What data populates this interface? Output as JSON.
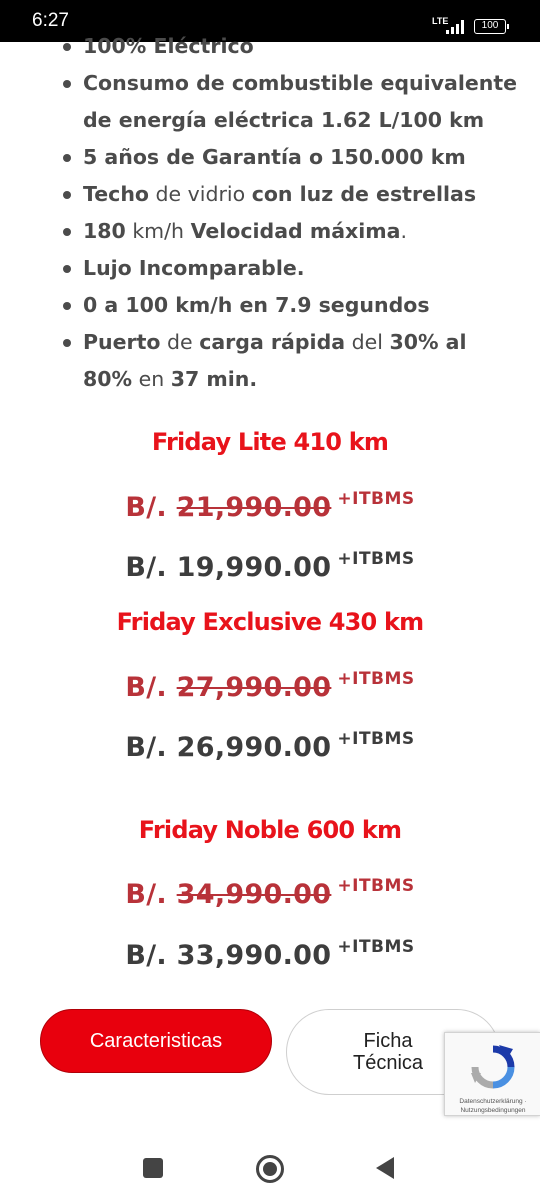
{
  "status_bar": {
    "time": "6:27",
    "network": "LTE",
    "battery": "100"
  },
  "features": [
    [
      {
        "t": "100% Eléctrico",
        "b": true
      }
    ],
    [
      {
        "t": "Consumo de combustible equivalente de energía eléctrica 1.62 L/100 km",
        "b": true
      }
    ],
    [
      {
        "t": "5 años de Garantía o 150.000 km",
        "b": true
      }
    ],
    [
      {
        "t": "Techo",
        "b": true
      },
      {
        "t": " de vidrio ",
        "b": false
      },
      {
        "t": "con luz de estrellas",
        "b": true
      }
    ],
    [
      {
        "t": "180",
        "b": true
      },
      {
        "t": " km/h ",
        "b": false
      },
      {
        "t": "Velocidad máxima",
        "b": true
      },
      {
        "t": ".",
        "b": false
      }
    ],
    [
      {
        "t": "Lujo Incomparable.",
        "b": true
      }
    ],
    [
      {
        "t": "0 a 100 km/h en 7.9 segundos",
        "b": true
      }
    ],
    [
      {
        "t": "Puerto",
        "b": true
      },
      {
        "t": " de ",
        "b": false
      },
      {
        "t": "carga rápida",
        "b": true
      },
      {
        "t": " del ",
        "b": false
      },
      {
        "t": "30% al 80%",
        "b": true
      },
      {
        "t": " en ",
        "b": false
      },
      {
        "t": "37 min.",
        "b": true
      }
    ]
  ],
  "models": [
    {
      "title": "Friday Lite 410 km",
      "currency": "B/.",
      "old_price": "21,990.00",
      "new_price": "19,990.00",
      "tax": "+ITBMS"
    },
    {
      "title": "Friday Exclusive 430 km",
      "currency": "B/.",
      "old_price": "27,990.00",
      "new_price": "26,990.00",
      "tax": "+ITBMS"
    },
    {
      "title": "Friday Noble 600 km",
      "currency": "B/.",
      "old_price": "34,990.00",
      "new_price": "33,990.00",
      "tax": "+ITBMS"
    }
  ],
  "buttons": {
    "characteristics": "Caracteristicas",
    "tech_sheet_line1": "Ficha",
    "tech_sheet_line2": "Técnica"
  },
  "recaptcha": {
    "privacy": "Datenschutzerklärung",
    "sep": " · ",
    "terms": "Nutzungsbedingungen"
  },
  "colors": {
    "accent_red": "#e8131b",
    "old_price_red": "#b83239",
    "text_gray": "#4b4b4b"
  }
}
